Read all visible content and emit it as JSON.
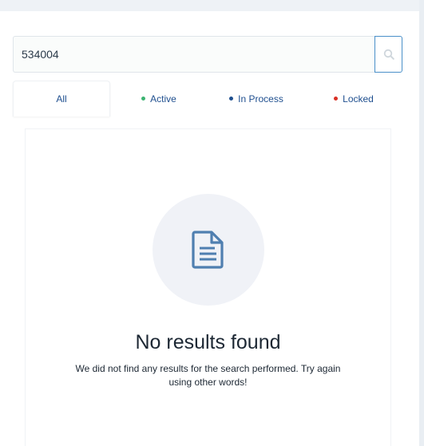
{
  "search": {
    "value": "534004",
    "button_icon": "search-icon"
  },
  "tabs": [
    {
      "label": "All",
      "dot_color": null
    },
    {
      "label": "Active",
      "dot_color": "#3cb371"
    },
    {
      "label": "In Process",
      "dot_color": "#1f4f8f"
    },
    {
      "label": "Locked",
      "dot_color": "#d93025"
    }
  ],
  "empty_state": {
    "icon": "document-icon",
    "title": "No results found",
    "message": "We did not find any results for the search performed. Try again using other words!"
  },
  "colors": {
    "accent": "#4a90c9",
    "tab_text": "#1f4f8f"
  }
}
